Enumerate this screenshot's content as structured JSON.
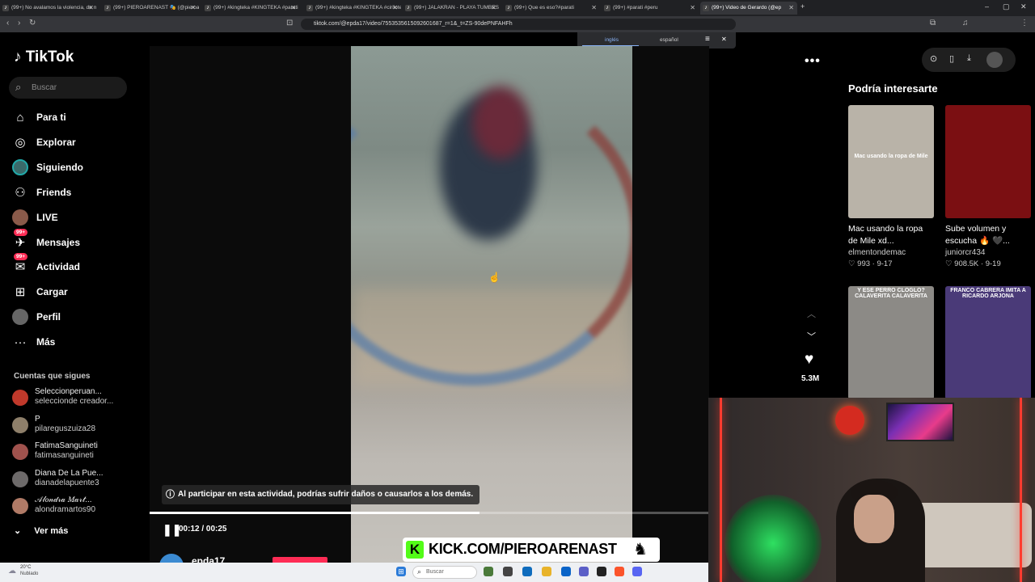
{
  "browser": {
    "tabs": [
      {
        "title": "(99+) No avalamos la violencia, de n",
        "active": false
      },
      {
        "title": "(99+) PIEROARENAST 🎭 (@pieroaren",
        "active": false
      },
      {
        "title": "(99+) #kingteka #KINGTEKA #parati",
        "active": false
      },
      {
        "title": "(99+) #kingteka #KINGTEKA #cirilote",
        "active": false
      },
      {
        "title": "(99+) JALAKRAN - PLAYA TUMBES xd",
        "active": false
      },
      {
        "title": "(99+) Que es eso?#parati",
        "active": false
      },
      {
        "title": "(99+) #parati #peru",
        "active": false
      },
      {
        "title": "(99+) Video de Gerardo (@ep",
        "active": true
      }
    ],
    "url": "tiktok.com/@epda17/video/7553535615092601687_r=1&_t=ZS-90dePNFAHFh",
    "translate": {
      "lang1": "inglés",
      "lang2": "español"
    }
  },
  "sidebar": {
    "logo": "TikTok",
    "search_placeholder": "Buscar",
    "nav": [
      {
        "label": "Para ti",
        "icon": "home-icon"
      },
      {
        "label": "Explorar",
        "icon": "compass-icon"
      },
      {
        "label": "Siguiendo",
        "icon": "following-avatar-icon"
      },
      {
        "label": "Friends",
        "icon": "friends-icon"
      },
      {
        "label": "LIVE",
        "icon": "live-icon"
      },
      {
        "label": "Mensajes",
        "icon": "messages-icon",
        "badge": "99+"
      },
      {
        "label": "Actividad",
        "icon": "activity-icon",
        "badge": "99+"
      },
      {
        "label": "Cargar",
        "icon": "upload-icon"
      },
      {
        "label": "Perfil",
        "icon": "profile-icon"
      },
      {
        "label": "Más",
        "icon": "more-icon"
      }
    ],
    "following_title": "Cuentas que sigues",
    "following": [
      {
        "name": "Seleccionperuan...",
        "handle": "seleccionde creador...",
        "color": "#c0392b"
      },
      {
        "name": "P",
        "handle": "pilareguszuiza28",
        "color": "#8e7f6a"
      },
      {
        "name": "FatimaSanguineti",
        "handle": "fatimasanguineti",
        "color": "#a0524d"
      },
      {
        "name": "Diana De La Pue...",
        "handle": "dianadelapuente3",
        "color": "#6d6a6a"
      },
      {
        "name": "𝒜𝓁𝑜𝓃𝒹𝓇𝒶 𝑀𝒶𝓇𝓉...",
        "handle": "alondramartos90",
        "color": "#b07a66"
      }
    ],
    "see_more": "Ver más"
  },
  "video": {
    "warning": "Al participar en esta actividad, podrías sufrir daños o causarlos a los demás.",
    "time": "00:12 / 00:25",
    "progress": 0.59,
    "author": "epda17",
    "likes": "5.3M"
  },
  "recommendations": {
    "title": "Podría interesarte",
    "items": [
      {
        "caption": "Mac usando la ropa de Mile xd...",
        "user": "elmentondemac",
        "likes": "993",
        "date": "9-17",
        "thumb_text": "Mac usando la ropa de Mile",
        "thumb_color": "#b9b3a8"
      },
      {
        "caption": "Sube volumen y escucha 🔥 🖤...",
        "user": "juniorcr434",
        "likes": "908.5K",
        "date": "9-19",
        "thumb_text": "",
        "thumb_color": "#7b0f12"
      },
      {
        "caption": "",
        "user": "",
        "likes": "",
        "date": "",
        "thumb_text": "Y ESE PERRO CLOGLO? CALAVERITA CALAVERITA",
        "thumb_color": "#8c8a86"
      },
      {
        "caption": "",
        "user": "",
        "likes": "",
        "date": "",
        "thumb_text": "FRANCO CABRERA IMITA A RICARDO ARJONA",
        "thumb_color": "#4a3a78"
      }
    ]
  },
  "overlay": {
    "kick_text": "KICK.COM/PIEROARENAST"
  },
  "taskbar": {
    "weather_temp": "20°C",
    "weather_desc": "Nublado",
    "search_placeholder": "Buscar"
  }
}
